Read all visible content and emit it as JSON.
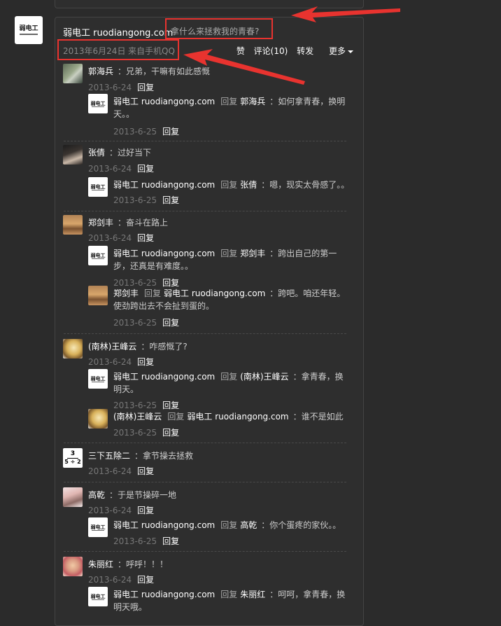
{
  "post": {
    "author": "弱电工 ruodiangong.com",
    "text": "拿什么来拯救我的青春?",
    "date": "2013年6月24日",
    "source": "来自手机QQ",
    "like": "赞",
    "comments": "评论(10)",
    "share": "转发",
    "more": "更多"
  },
  "logo_text": "弱电工",
  "reply_word": "回复",
  "colors": {
    "annotation": "#e8332f",
    "background": "#2b2b2b"
  },
  "threads": [
    {
      "name": "郭海兵",
      "text": "：兄弟，干嘛有如此感慨",
      "date": "2013-6-24",
      "avatar": "landscape",
      "replies": [
        {
          "from": "弱电工 ruodiangong.com",
          "to": "郭海兵",
          "text": "：如何拿青春，换明天。。",
          "date": "2013-6-25",
          "avatar": "logo"
        }
      ]
    },
    {
      "name": "张倩",
      "text": "：过好当下",
      "date": "2013-6-24",
      "avatar": "portrait-dark",
      "replies": [
        {
          "from": "弱电工 ruodiangong.com",
          "to": "张倩",
          "text": "：嗯，现实太骨感了。。",
          "date": "2013-6-25",
          "avatar": "logo"
        }
      ]
    },
    {
      "name": "郑剑丰",
      "text": "：奋斗在路上",
      "date": "2013-6-24",
      "avatar": "desert",
      "replies": [
        {
          "from": "弱电工 ruodiangong.com",
          "to": "郑剑丰",
          "text": "：跨出自己的第一步，还真是有难度。。",
          "date": "2013-6-25",
          "avatar": "logo"
        },
        {
          "from": "郑剑丰",
          "to": "弱电工 ruodiangong.com",
          "text": "：跨吧。咱还年轻。使劲跨出去不会扯到蛋的。",
          "date": "2013-6-25",
          "avatar": "desert"
        }
      ]
    },
    {
      "name": "(南林)王峰云",
      "text": "：咋感慨了?",
      "date": "2013-6-24",
      "avatar": "cartoon",
      "replies": [
        {
          "from": "弱电工 ruodiangong.com",
          "to": "(南林)王峰云",
          "text": "：拿青春，换明天。",
          "date": "2013-6-25",
          "avatar": "logo"
        },
        {
          "from": "(南林)王峰云",
          "to": "弱电工 ruodiangong.com",
          "text": "：谁不是如此",
          "date": "2013-6-25",
          "avatar": "cartoon"
        }
      ]
    },
    {
      "name": "三下五除二",
      "text": "：拿节操去拯救",
      "date": "2013-6-24",
      "avatar": "math",
      "math_top": "3",
      "math_bottom": "5 ÷ 2",
      "replies": []
    },
    {
      "name": "高乾",
      "text": "：于是节操碎一地",
      "date": "2013-6-24",
      "avatar": "girl",
      "replies": [
        {
          "from": "弱电工 ruodiangong.com",
          "to": "高乾",
          "text": "：你个蛋疼的家伙。。",
          "date": "2013-6-25",
          "avatar": "logo"
        }
      ]
    },
    {
      "name": "朱丽红",
      "text": "：呼呼！！！",
      "date": "2013-6-24",
      "avatar": "child",
      "replies": [
        {
          "from": "弱电工 ruodiangong.com",
          "to": "朱丽红",
          "text": "：呵呵，拿青春，换明天哦。",
          "date": "",
          "avatar": "logo"
        }
      ]
    }
  ]
}
